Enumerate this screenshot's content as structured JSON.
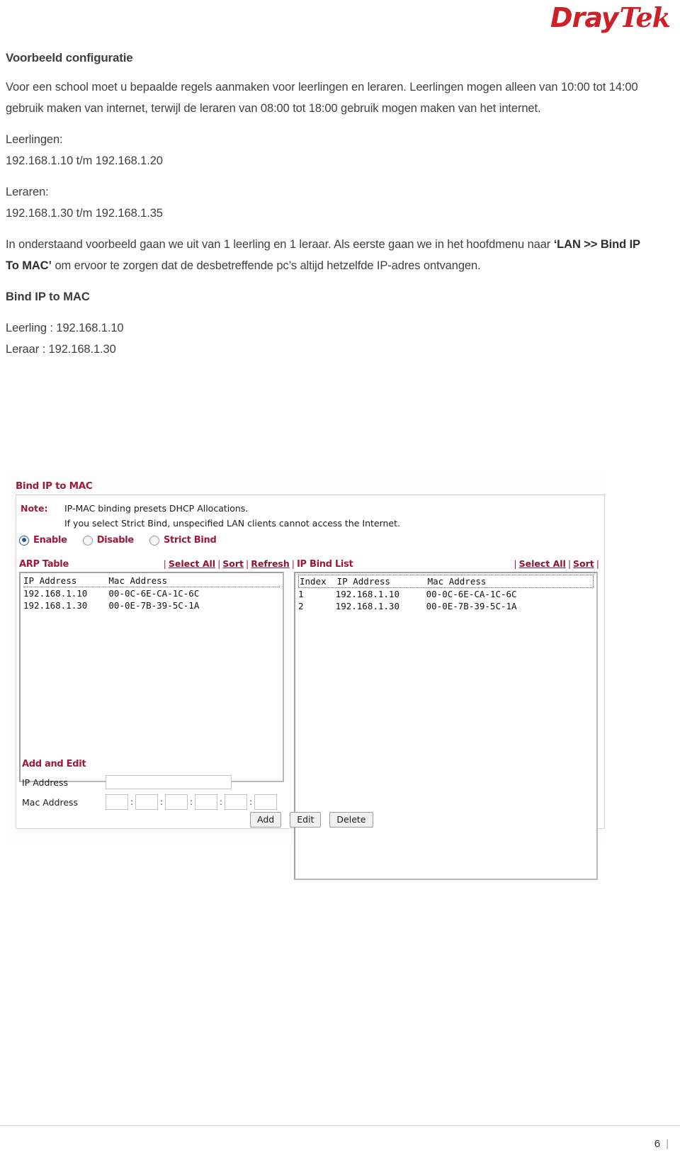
{
  "brand": {
    "first": "Dray",
    "second": "Tek"
  },
  "document": {
    "section_title": "Voorbeeld configuratie",
    "intro_paragraph": "Voor een school moet u bepaalde regels aanmaken voor leerlingen en leraren. Leerlingen mogen alleen van 10:00 tot 14:00 gebruik maken van internet, terwijl de leraren van 08:00 tot 18:00 gebruik mogen maken van het internet.",
    "students_label": "Leerlingen:",
    "students_range": "192.168.1.10 t/m 192.168.1.20",
    "teachers_label": "Leraren:",
    "teachers_range": "192.168.1.30 t/m 192.168.1.35",
    "example_part1": "In onderstaand voorbeeld gaan we uit van 1 leerling en 1 leraar. Als eerste gaan we in het hoofdmenu naar ",
    "example_menu_path": "‘LAN >> Bind IP To MAC’",
    "example_part2": " om ervoor te zorgen dat de desbetreffende pc’s altijd hetzelfde IP-adres ontvangen.",
    "bind_heading": "Bind IP to MAC",
    "student_entry": "Leerling : 192.168.1.10",
    "teacher_entry": "Leraar : 192.168.1.30"
  },
  "screenshot": {
    "title": "Bind IP to MAC",
    "note": {
      "label": "Note:",
      "line1": "IP-MAC binding presets DHCP Allocations.",
      "line2": "If you select Strict Bind, unspecified LAN clients cannot access the Internet."
    },
    "modes": [
      {
        "label": "Enable",
        "selected": true
      },
      {
        "label": "Disable",
        "selected": false
      },
      {
        "label": "Strict Bind",
        "selected": false
      }
    ],
    "arp_table": {
      "title": "ARP Table",
      "links": [
        "Select All",
        "Sort",
        "Refresh"
      ],
      "columns": [
        "IP Address",
        "Mac Address"
      ],
      "header_line": "IP Address      Mac Address",
      "rows": [
        {
          "ip": "192.168.1.10",
          "mac": "00-0C-6E-CA-1C-6C",
          "line": "192.168.1.10    00-0C-6E-CA-1C-6C"
        },
        {
          "ip": "192.168.1.30",
          "mac": "00-0E-7B-39-5C-1A",
          "line": "192.168.1.30    00-0E-7B-39-5C-1A"
        }
      ]
    },
    "ip_bind_list": {
      "title": "IP Bind List",
      "links": [
        "Select All",
        "Sort"
      ],
      "columns": [
        "Index",
        "IP Address",
        "Mac Address"
      ],
      "header_line": "Index  IP Address       Mac Address",
      "rows": [
        {
          "index": "1",
          "ip": "192.168.1.10",
          "mac": "00-0C-6E-CA-1C-6C",
          "line": "1      192.168.1.10     00-0C-6E-CA-1C-6C"
        },
        {
          "index": "2",
          "ip": "192.168.1.30",
          "mac": "00-0E-7B-39-5C-1A",
          "line": "2      192.168.1.30     00-0E-7B-39-5C-1A"
        }
      ]
    },
    "add_and_edit": {
      "title": "Add and Edit",
      "ip_address_label": "IP Address",
      "ip_address_value": "",
      "mac_address_label": "Mac Address",
      "mac_segments": [
        "",
        "",
        "",
        "",
        "",
        ""
      ],
      "separator": ":"
    },
    "buttons": [
      "Add",
      "Edit",
      "Delete"
    ]
  },
  "footer": {
    "page_number": "6"
  }
}
